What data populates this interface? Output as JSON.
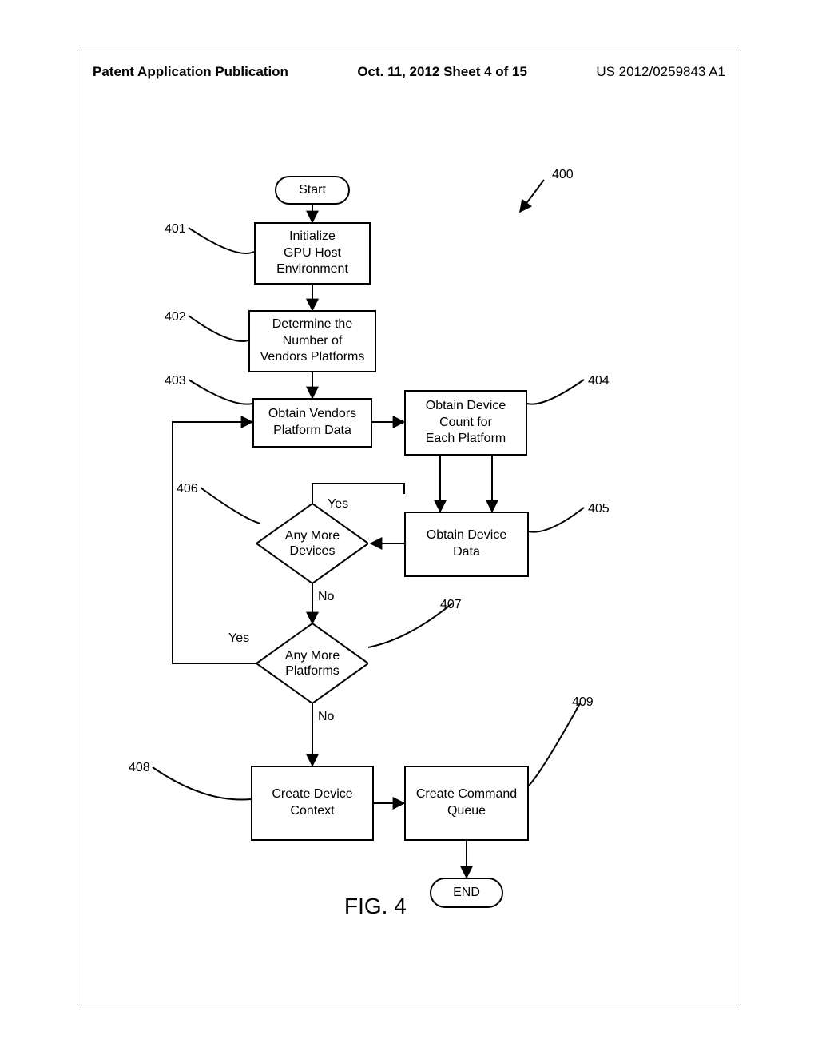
{
  "header": {
    "left": "Patent Application Publication",
    "center": "Oct. 11, 2012  Sheet 4 of 15",
    "right": "US 2012/0259843 A1"
  },
  "nodes": {
    "start": "Start",
    "n401": "Initialize\nGPU Host\nEnvironment",
    "n402": "Determine the\nNumber of\nVendors Platforms",
    "n403": "Obtain Vendors\nPlatform Data",
    "n404": "Obtain Device\nCount for\nEach Platform",
    "n405": "Obtain Device\nData",
    "n406": "Any More\nDevices",
    "n407": "Any More\nPlatforms",
    "n408": "Create Device\nContext",
    "n409": "Create Command\nQueue",
    "end": "END"
  },
  "edge_labels": {
    "d406_yes": "Yes",
    "d406_no": "No",
    "d407_yes": "Yes",
    "d407_no": "No"
  },
  "refs": {
    "r400": "400",
    "r401": "401",
    "r402": "402",
    "r403": "403",
    "r404": "404",
    "r405": "405",
    "r406": "406",
    "r407": "407",
    "r408": "408",
    "r409": "409"
  },
  "figure": "FIG. 4"
}
